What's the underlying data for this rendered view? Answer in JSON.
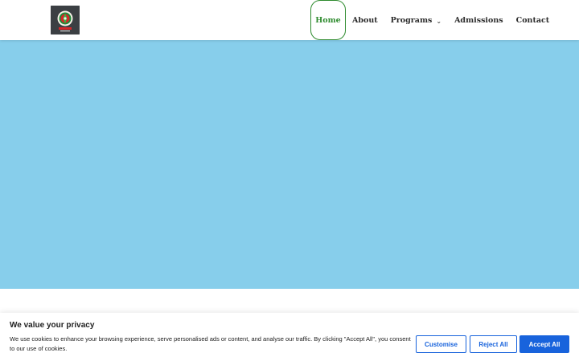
{
  "colors": {
    "hero_background": "#87ceeb",
    "nav_active": "#2e8b2e",
    "accent_blue": "#1863dc"
  },
  "header": {
    "logo_icon": "school-crest-logo",
    "nav": {
      "home": "Home",
      "about": "About",
      "programs": "Programs",
      "programs_icon": "chevron-down-icon",
      "admissions": "Admissions",
      "contact": "Contact"
    }
  },
  "cookie_banner": {
    "title": "We value your privacy",
    "text": "We use cookies to enhance your browsing experience, serve personalised ads or content, and analyse our traffic. By clicking \"Accept All\", you consent to our use of cookies.",
    "customise_label": "Customise",
    "reject_label": "Reject All",
    "accept_label": "Accept All"
  }
}
